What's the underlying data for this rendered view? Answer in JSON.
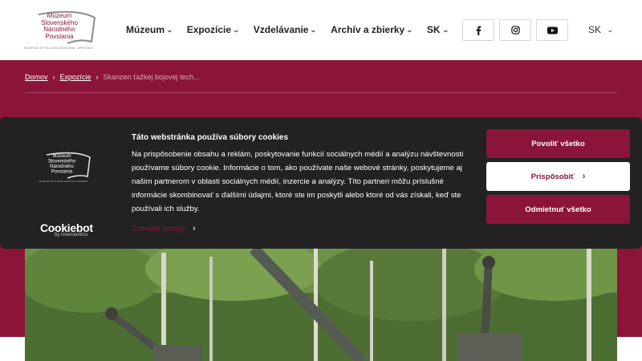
{
  "logo": {
    "lines": [
      "Múzeum",
      "Slovenského",
      "Národného",
      "Povstania"
    ],
    "subtitle": "MUSEUM OF SLOVAK NATIONAL UPRISING"
  },
  "nav": {
    "items": [
      {
        "label": "Múzeum"
      },
      {
        "label": "Expozície"
      },
      {
        "label": "Vzdelávanie"
      },
      {
        "label": "Archív a zbierky"
      },
      {
        "label": "SK"
      }
    ]
  },
  "social": {
    "icons": [
      "facebook-icon",
      "instagram-icon",
      "youtube-icon"
    ]
  },
  "language": {
    "current": "SK"
  },
  "breadcrumb": {
    "home": "Domov",
    "section": "Expozície",
    "current": "Skanzen ťažkej bojovej tech..."
  },
  "cookie": {
    "title": "Táto webstránka používa súbory cookies",
    "body": "Na prispôsobenie obsahu a reklám, poskytovanie funkcií sociálnych médií a analýzu návštevnosti používame súbory cookie. Informácie o tom, ako používate naše webové stránky, poskytujeme aj našim partnerom v oblasti sociálnych médií, inzercie a analýzy. Títo partneri môžu príslušné informácie skombinovať s ďalšími údajmi, ktoré ste im poskytli alebo ktoré od vás získali, keď ste používali ich služby.",
    "details_link": "Zobraziť detaily",
    "brand": "Cookiebot",
    "brand_by": "by Usercentrics",
    "allow_all": "Povoliť všetko",
    "customize": "Prispôsobiť",
    "deny_all": "Odmietnuť všetko"
  },
  "colors": {
    "brand": "#8b1538",
    "banner_bg": "#222222"
  }
}
